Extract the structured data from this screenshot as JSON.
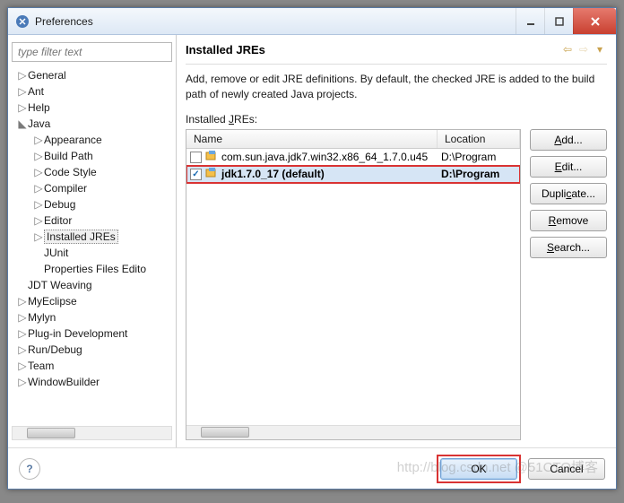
{
  "window": {
    "title": "Preferences"
  },
  "filter": {
    "placeholder": "type filter text"
  },
  "tree": [
    {
      "label": "General",
      "depth": 0,
      "arrow": "▷",
      "selected": false
    },
    {
      "label": "Ant",
      "depth": 0,
      "arrow": "▷",
      "selected": false
    },
    {
      "label": "Help",
      "depth": 0,
      "arrow": "▷",
      "selected": false
    },
    {
      "label": "Java",
      "depth": 0,
      "arrow": "▲",
      "selected": false
    },
    {
      "label": "Appearance",
      "depth": 1,
      "arrow": "▷",
      "selected": false
    },
    {
      "label": "Build Path",
      "depth": 1,
      "arrow": "▷",
      "selected": false
    },
    {
      "label": "Code Style",
      "depth": 1,
      "arrow": "▷",
      "selected": false
    },
    {
      "label": "Compiler",
      "depth": 1,
      "arrow": "▷",
      "selected": false
    },
    {
      "label": "Debug",
      "depth": 1,
      "arrow": "▷",
      "selected": false
    },
    {
      "label": "Editor",
      "depth": 1,
      "arrow": "▷",
      "selected": false
    },
    {
      "label": "Installed JREs",
      "depth": 1,
      "arrow": "▷",
      "selected": true
    },
    {
      "label": "JUnit",
      "depth": 1,
      "arrow": "",
      "selected": false
    },
    {
      "label": "Properties Files Edito",
      "depth": 1,
      "arrow": "",
      "selected": false
    },
    {
      "label": "JDT Weaving",
      "depth": 0,
      "arrow": "",
      "selected": false
    },
    {
      "label": "MyEclipse",
      "depth": 0,
      "arrow": "▷",
      "selected": false
    },
    {
      "label": "Mylyn",
      "depth": 0,
      "arrow": "▷",
      "selected": false
    },
    {
      "label": "Plug-in Development",
      "depth": 0,
      "arrow": "▷",
      "selected": false
    },
    {
      "label": "Run/Debug",
      "depth": 0,
      "arrow": "▷",
      "selected": false
    },
    {
      "label": "Team",
      "depth": 0,
      "arrow": "▷",
      "selected": false
    },
    {
      "label": "WindowBuilder",
      "depth": 0,
      "arrow": "▷",
      "selected": false
    }
  ],
  "page": {
    "title": "Installed JREs",
    "description": "Add, remove or edit JRE definitions. By default, the checked JRE is added to the build path of newly created Java projects.",
    "list_label": "Installed JREs:"
  },
  "columns": {
    "name": "Name",
    "location": "Location"
  },
  "rows": [
    {
      "checked": false,
      "name": "com.sun.java.jdk7.win32.x86_64_1.7.0.u45",
      "location": "D:\\Program",
      "selected": false
    },
    {
      "checked": true,
      "name": "jdk1.7.0_17 (default)",
      "location": "D:\\Program",
      "selected": true
    }
  ],
  "buttons": {
    "add": "Add...",
    "edit": "Edit...",
    "duplicate": "Duplicate...",
    "remove": "Remove",
    "search": "Search..."
  },
  "footer": {
    "ok": "OK",
    "cancel": "Cancel"
  },
  "watermark": "http://blog.csdn.net @51CTO博客"
}
